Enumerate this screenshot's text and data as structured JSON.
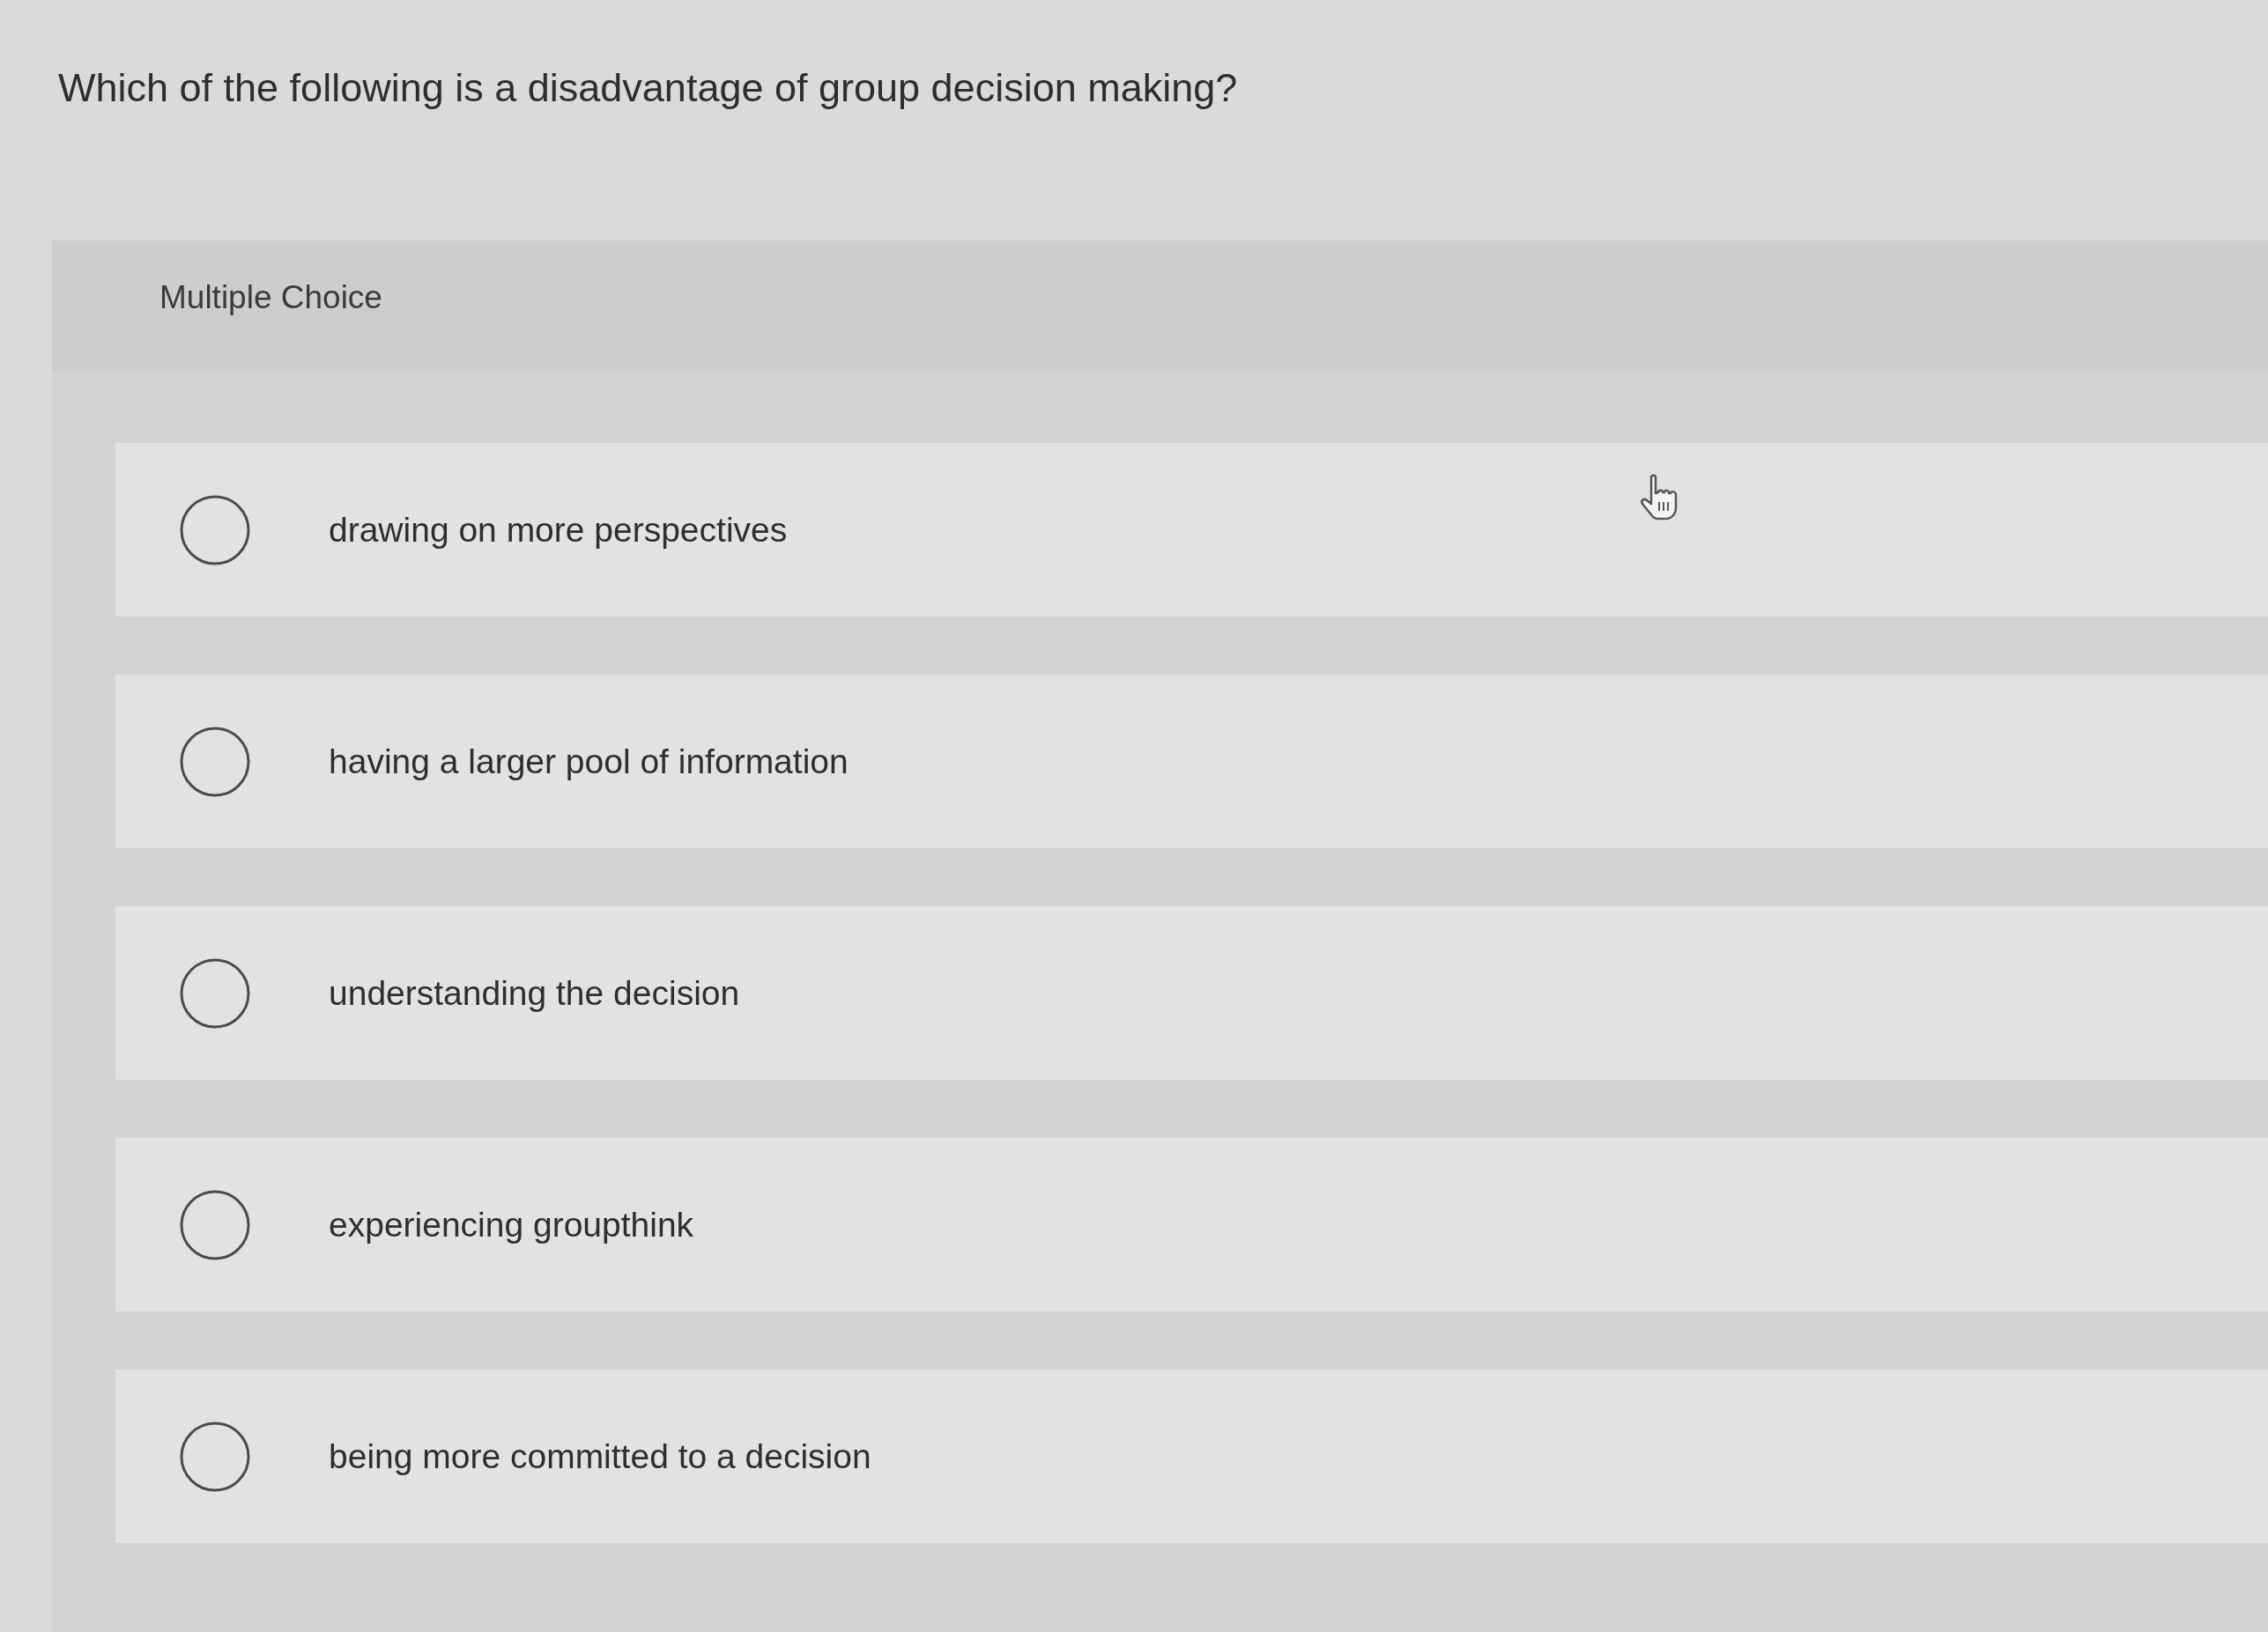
{
  "question": "Which of the following is a disadvantage of group decision making?",
  "panel": {
    "label": "Multiple Choice"
  },
  "options": [
    {
      "text": "drawing on more perspectives",
      "selected": false
    },
    {
      "text": "having a larger pool of information",
      "selected": false
    },
    {
      "text": "understanding the decision",
      "selected": false
    },
    {
      "text": "experiencing groupthink",
      "selected": false
    },
    {
      "text": "being more committed to a decision",
      "selected": false
    }
  ]
}
